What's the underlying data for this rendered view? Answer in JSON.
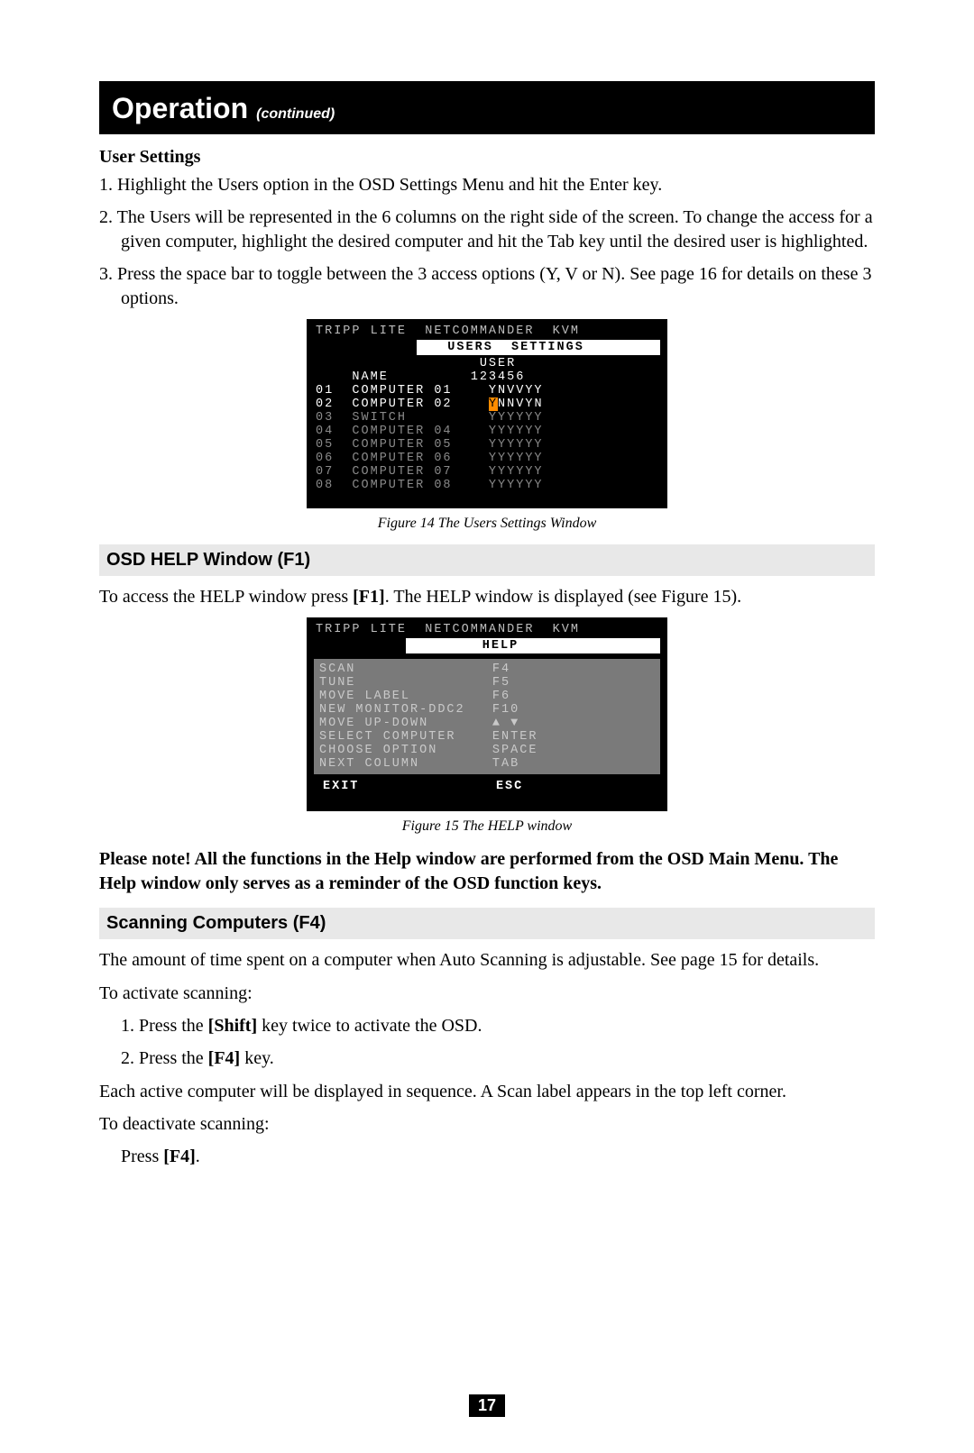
{
  "header": {
    "title": "Operation",
    "continued": "(continued)"
  },
  "userSettings": {
    "heading": "User Settings",
    "steps": [
      "Highlight the Users option in the OSD Settings Menu and hit the Enter key.",
      "The Users will be represented in the 6 columns on the right side of the screen. To change the access for a given computer, highlight the desired computer and hit the Tab key until the desired user is highlighted.",
      "Press the space bar to toggle between the 3 access options (Y, V or N). See page 16 for details on these 3 options."
    ]
  },
  "figure14": {
    "caption": "Figure 14 The Users Settings Window",
    "topLine": "TRIPP LITE  NETCOMMANDER  KVM",
    "banner": "   USERS  SETTINGS   ",
    "userLabel": "USER",
    "nameLabel": "NAME",
    "userCols": "123456",
    "rows": [
      {
        "num": "01",
        "name": "COMPUTER 01",
        "perm": "YNVVYY",
        "active": true,
        "hl": -1
      },
      {
        "num": "02",
        "name": "COMPUTER 02",
        "perm": "YNNVYN",
        "active": true,
        "hl": 0
      },
      {
        "num": "03",
        "name": "SWITCH",
        "perm": "YYYYYY",
        "active": false,
        "hl": -1
      },
      {
        "num": "04",
        "name": "COMPUTER 04",
        "perm": "YYYYYY",
        "active": false,
        "hl": -1
      },
      {
        "num": "05",
        "name": "COMPUTER 05",
        "perm": "YYYYYY",
        "active": false,
        "hl": -1
      },
      {
        "num": "06",
        "name": "COMPUTER 06",
        "perm": "YYYYYY",
        "active": false,
        "hl": -1
      },
      {
        "num": "07",
        "name": "COMPUTER 07",
        "perm": "YYYYYY",
        "active": false,
        "hl": -1
      },
      {
        "num": "08",
        "name": "COMPUTER 08",
        "perm": "YYYYYY",
        "active": false,
        "hl": -1
      }
    ]
  },
  "osdHelp": {
    "heading": "OSD HELP Window (F1)",
    "intro_pre": "To access the HELP window press ",
    "intro_key": "[F1]",
    "intro_post": ". The HELP window is displayed (see Figure 15)."
  },
  "figure15": {
    "caption": "Figure 15 The HELP window",
    "topLine": "TRIPP LITE  NETCOMMANDER  KVM",
    "banner": "        HELP         ",
    "rows": [
      {
        "label": "SCAN",
        "key": "F4"
      },
      {
        "label": "TUNE",
        "key": "F5"
      },
      {
        "label": "MOVE LABEL",
        "key": "F6"
      },
      {
        "label": "NEW MONITOR-DDC2",
        "key": "F10"
      },
      {
        "label": "MOVE UP-DOWN",
        "key": "▲ ▼"
      },
      {
        "label": "SELECT COMPUTER",
        "key": "ENTER"
      },
      {
        "label": "CHOOSE OPTION",
        "key": "SPACE"
      },
      {
        "label": "NEXT COLUMN",
        "key": "TAB"
      }
    ],
    "exit": {
      "label": "EXIT",
      "key": "ESC"
    }
  },
  "note": "Please note! All the functions in the Help window are performed from the OSD Main Menu. The Help window only serves as a reminder of the OSD function keys.",
  "scanning": {
    "heading": "Scanning Computers (F4)",
    "intro": "The amount of time spent on a computer when Auto Scanning is adjustable. See page 15 for details.",
    "activateLabel": "To activate scanning:",
    "step1_pre": "1. Press the ",
    "step1_key": "[Shift]",
    "step1_post": " key twice to activate the OSD.",
    "step2_pre": "2. Press the ",
    "step2_key": "[F4]",
    "step2_post": " key.",
    "each": "Each active computer will be displayed in sequence. A Scan label appears in the top left corner.",
    "deactivateLabel": "To deactivate scanning:",
    "deact_pre": "Press ",
    "deact_key": "[F4]",
    "deact_post": "."
  },
  "pageNumber": "17"
}
